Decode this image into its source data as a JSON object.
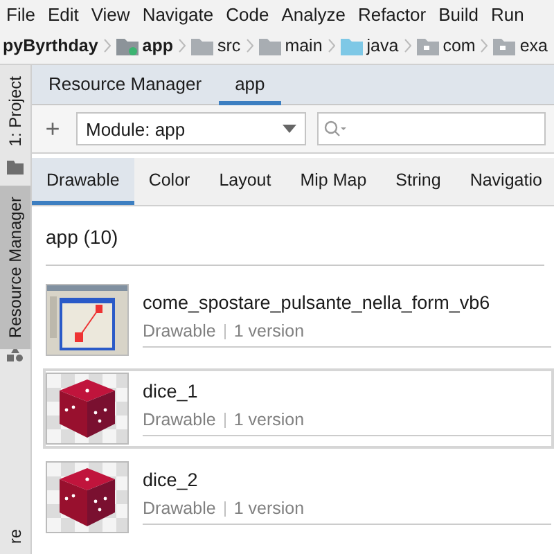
{
  "menu": [
    "File",
    "Edit",
    "View",
    "Navigate",
    "Code",
    "Analyze",
    "Refactor",
    "Build",
    "Run"
  ],
  "breadcrumb": [
    {
      "label": "pyByrthday",
      "kind": "project"
    },
    {
      "label": "app",
      "kind": "module"
    },
    {
      "label": "src",
      "kind": "folder"
    },
    {
      "label": "main",
      "kind": "folder"
    },
    {
      "label": "java",
      "kind": "source"
    },
    {
      "label": "com",
      "kind": "package"
    },
    {
      "label": "exa",
      "kind": "package"
    }
  ],
  "side_tools": [
    {
      "label": "1: Project",
      "selected": false
    },
    {
      "label": "Resource Manager",
      "selected": true
    },
    {
      "label": "re",
      "selected": false
    }
  ],
  "tabs": [
    {
      "label": "Resource Manager",
      "selected": false
    },
    {
      "label": "app",
      "selected": true
    }
  ],
  "toolbar": {
    "add": "+",
    "module": "Module: app"
  },
  "categories": [
    {
      "label": "Drawable",
      "selected": true
    },
    {
      "label": "Color",
      "selected": false
    },
    {
      "label": "Layout",
      "selected": false
    },
    {
      "label": "Mip Map",
      "selected": false
    },
    {
      "label": "String",
      "selected": false
    },
    {
      "label": "Navigatio",
      "selected": false
    }
  ],
  "section": {
    "title": "app (10)"
  },
  "resources": [
    {
      "name": "come_spostare_pulsante_nella_form_vb6",
      "type": "Drawable",
      "versions": "1 version",
      "kind": "screenshot",
      "selected": false
    },
    {
      "name": "dice_1",
      "type": "Drawable",
      "versions": "1 version",
      "kind": "dice",
      "selected": true
    },
    {
      "name": "dice_2",
      "type": "Drawable",
      "versions": "1 version",
      "kind": "dice",
      "selected": false
    }
  ]
}
